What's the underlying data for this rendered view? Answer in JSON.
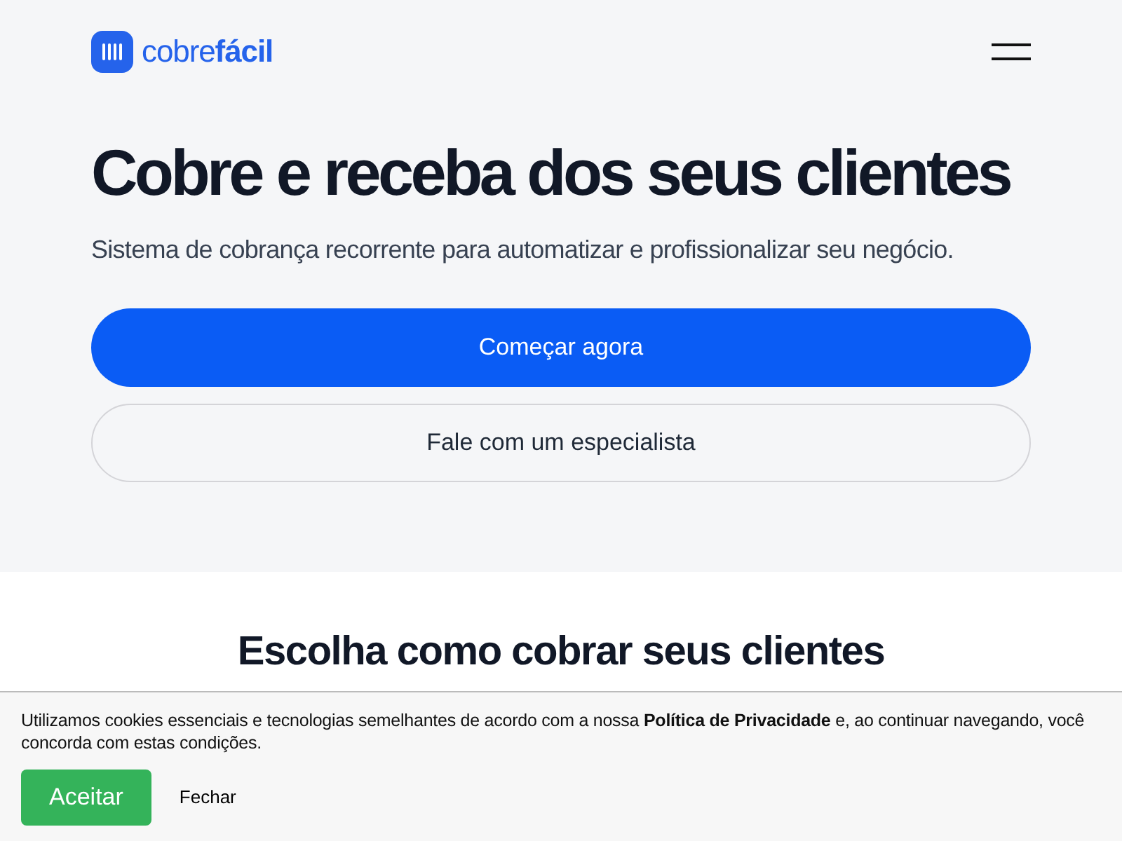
{
  "header": {
    "logo": "cobre**fácil**"
  },
  "hero": {
    "title": "Cobre e receba dos seus clientes",
    "subtitle": "Sistema de cobrança recorrente para automatizar e profissionalizar seu negócio.",
    "buttons": [
      {
        "label": "Começar agora",
        "kind": "primary"
      },
      {
        "label": "Fale com um especialista",
        "kind": "secondary"
      }
    ]
  },
  "section": {
    "title": "Escolha como cobrar seus clientes"
  },
  "cookie_banner": {
    "text": "Utilizamos cookies essenciais e tecnologias semelhantes de acordo com a nossa **Política de Privacidade** e, ao continuar navegando, você concorda com estas condições.",
    "buttons": [
      {
        "label": "Aceitar",
        "kind": "accept"
      },
      {
        "label": "Fechar",
        "kind": "close"
      }
    ]
  }
}
